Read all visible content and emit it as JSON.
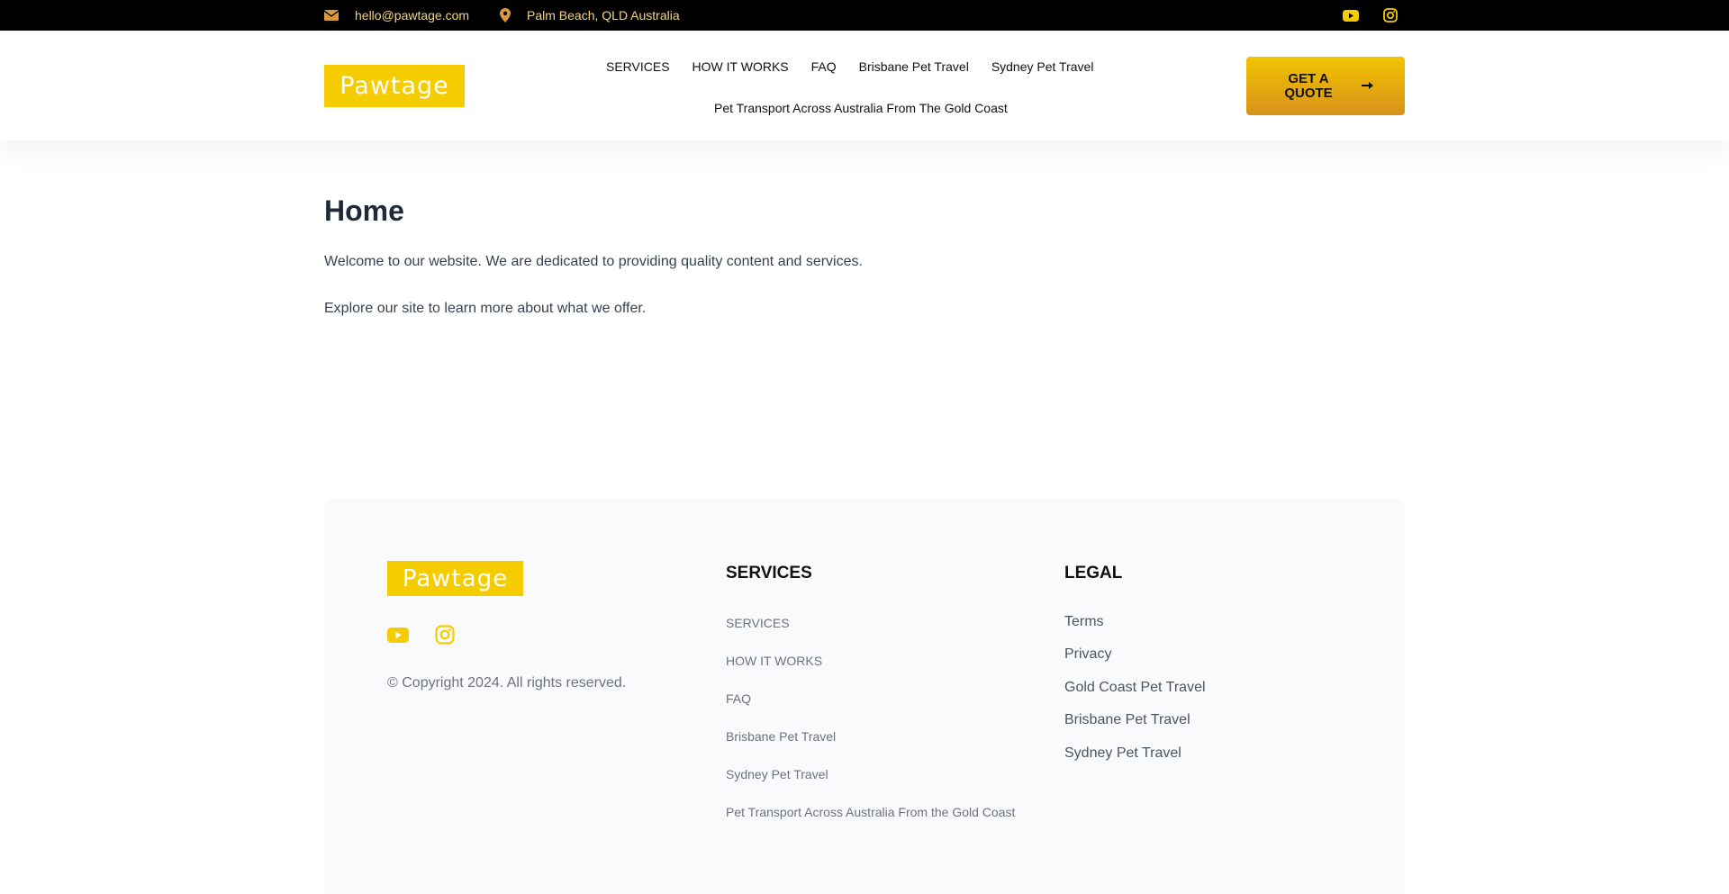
{
  "topbar": {
    "email": "hello@pawtage.com",
    "location": "Palm Beach, QLD Australia",
    "icons": [
      "envelope-icon",
      "map-pin-icon",
      "youtube-icon",
      "instagram-icon"
    ]
  },
  "brand": {
    "logo_text": "Pawtage",
    "accent": "#f5cc00",
    "button_gradient": [
      "#f2c300",
      "#d8921c"
    ]
  },
  "nav": {
    "items": [
      {
        "label": "SERVICES"
      },
      {
        "label": "HOW IT WORKS"
      },
      {
        "label": "FAQ"
      },
      {
        "label": "Brisbane Pet Travel"
      },
      {
        "label": "Sydney Pet Travel"
      },
      {
        "label": "Pet Transport Across Australia From The Gold Coast"
      }
    ],
    "cta": {
      "label": "GET A QUOTE",
      "icon": "arrow-right-icon"
    }
  },
  "main": {
    "title": "Home",
    "paragraphs": [
      "Welcome to our website. We are dedicated to providing quality content and services.",
      "Explore our site to learn more about what we offer."
    ]
  },
  "footer": {
    "logo_text": "Pawtage",
    "copyright": "© Copyright 2024. All rights reserved.",
    "services": {
      "heading": "SERVICES",
      "links": [
        "SERVICES",
        "HOW IT WORKS",
        "FAQ",
        "Brisbane Pet Travel",
        "Sydney Pet Travel",
        "Pet Transport Across Australia From the Gold Coast"
      ]
    },
    "legal": {
      "heading": "LEGAL",
      "links": [
        "Terms",
        "Privacy",
        "Gold Coast Pet Travel",
        "Brisbane Pet Travel",
        "Sydney Pet Travel"
      ]
    }
  }
}
